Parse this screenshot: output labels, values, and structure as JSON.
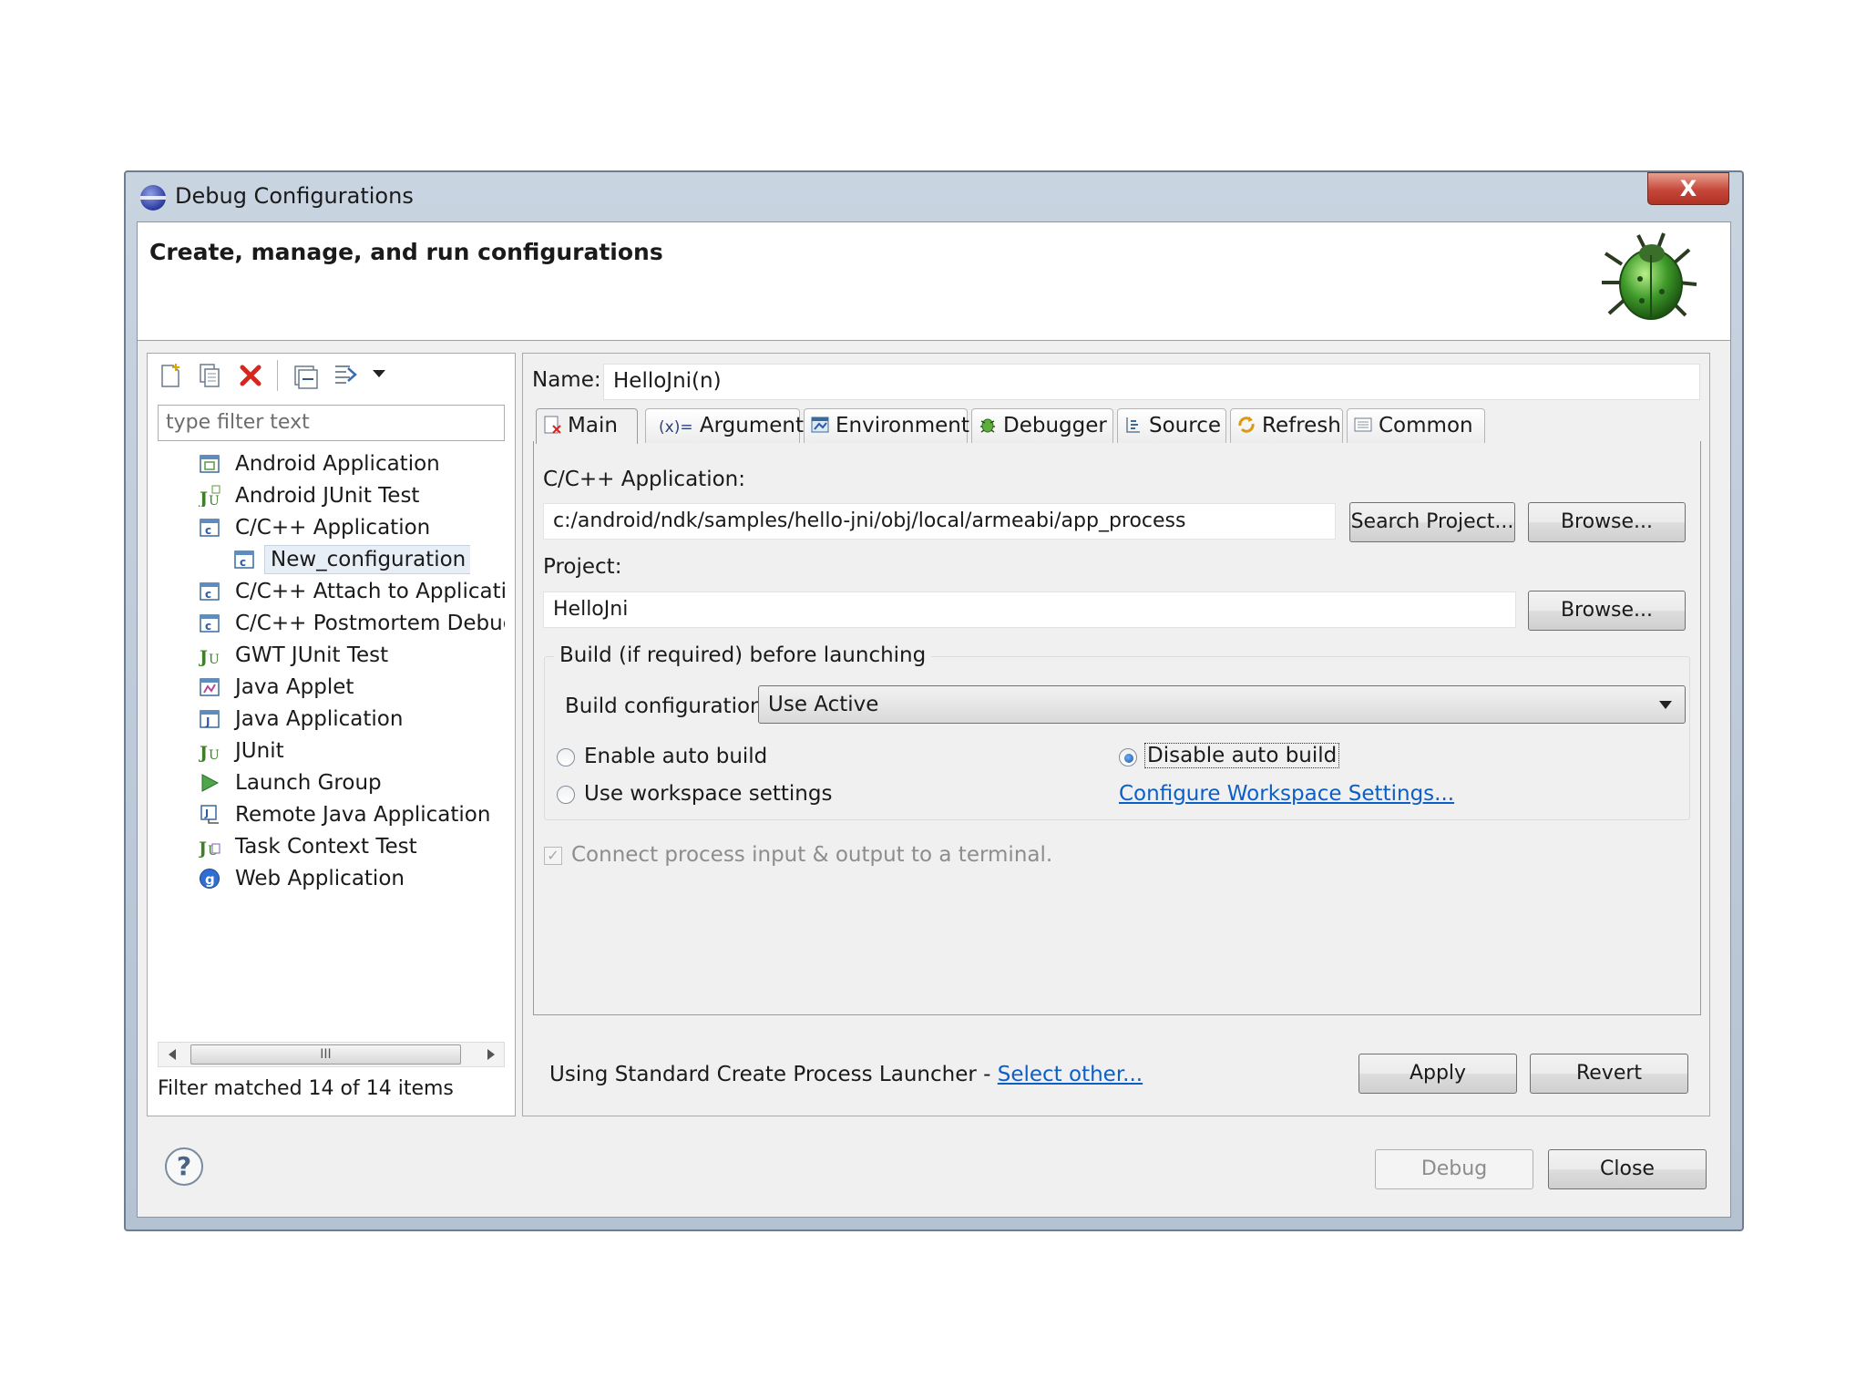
{
  "window": {
    "title": "Debug Configurations",
    "close_label": "X"
  },
  "banner": {
    "title": "Create, manage, and run configurations",
    "icon": "debug-bug-icon"
  },
  "left": {
    "toolbar_icons": [
      "new-launch-config-icon",
      "duplicate-icon",
      "delete-icon",
      "collapse-all-icon",
      "filter-icon",
      "dropdown-arrow-icon"
    ],
    "filter_placeholder": "type filter text",
    "tree": [
      {
        "label": "Android Application",
        "icon": "android-app-icon",
        "level": 0
      },
      {
        "label": "Android JUnit Test",
        "icon": "android-junit-icon",
        "level": 0
      },
      {
        "label": "C/C++ Application",
        "icon": "cpp-app-icon",
        "level": 0
      },
      {
        "label": "New_configuration",
        "icon": "cpp-config-icon",
        "level": 1,
        "selected": true
      },
      {
        "label": "C/C++ Attach to Application",
        "icon": "cpp-attach-icon",
        "level": 0
      },
      {
        "label": "C/C++ Postmortem Debugge",
        "icon": "cpp-postmortem-icon",
        "level": 0
      },
      {
        "label": "GWT JUnit Test",
        "icon": "gwt-junit-icon",
        "level": 0
      },
      {
        "label": "Java Applet",
        "icon": "java-applet-icon",
        "level": 0
      },
      {
        "label": "Java Application",
        "icon": "java-app-icon",
        "level": 0
      },
      {
        "label": "JUnit",
        "icon": "junit-icon",
        "level": 0
      },
      {
        "label": "Launch Group",
        "icon": "launch-group-icon",
        "level": 0
      },
      {
        "label": "Remote Java Application",
        "icon": "remote-java-icon",
        "level": 0
      },
      {
        "label": "Task Context Test",
        "icon": "task-context-icon",
        "level": 0
      },
      {
        "label": "Web Application",
        "icon": "web-app-icon",
        "level": 0
      }
    ],
    "scroll_thumb": "III",
    "filter_status": "Filter matched 14 of 14 items"
  },
  "right": {
    "name_label": "Name:",
    "name_value": "HelloJni(n)",
    "tabs": [
      {
        "label": "Main",
        "icon": "main-tab-icon",
        "active": true
      },
      {
        "label": "Arguments",
        "icon": "arguments-icon",
        "prefix": "(x)="
      },
      {
        "label": "Environment",
        "icon": "environment-icon"
      },
      {
        "label": "Debugger",
        "icon": "debugger-icon"
      },
      {
        "label": "Source",
        "icon": "source-icon"
      },
      {
        "label": "Refresh",
        "icon": "refresh-icon"
      },
      {
        "label": "Common",
        "icon": "common-icon"
      }
    ],
    "app_label": "C/C++ Application:",
    "app_value": "c:/android/ndk/samples/hello-jni/obj/local/armeabi/app_process",
    "search_project_label": "Search Project...",
    "browse_label": "Browse...",
    "project_label": "Project:",
    "project_value": "HelloJni",
    "build_group_title": "Build (if required) before launching",
    "build_config_label": "Build configuration:",
    "build_config_value": "Use Active",
    "radio_enable": "Enable auto build",
    "radio_disable": "Disable auto build",
    "radio_workspace": "Use workspace settings",
    "configure_link": "Configure Workspace Settings...",
    "terminal_checkbox": "Connect process input & output to a terminal.",
    "launcher_text": "Using Standard Create Process Launcher - ",
    "select_other_link": "Select other...",
    "apply_label": "Apply",
    "revert_label": "Revert"
  },
  "footer": {
    "help_label": "?",
    "debug_label": "Debug",
    "close_label": "Close"
  },
  "colors": {
    "title_gradient": "#c9d4e1",
    "close_red": "#c6473a",
    "link_blue": "#0b5fc7"
  }
}
